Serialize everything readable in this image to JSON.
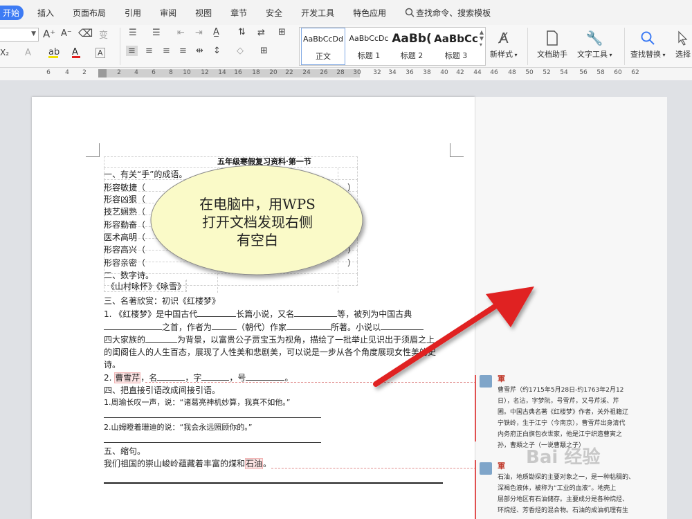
{
  "menu": {
    "start": "开始",
    "items": [
      "插入",
      "页面布局",
      "引用",
      "审阅",
      "视图",
      "章节",
      "安全",
      "开发工具",
      "特色应用"
    ],
    "search": "查找命令、搜索模板"
  },
  "ribbon": {
    "styles": [
      {
        "preview": "AaBbCcDd",
        "name": "正文"
      },
      {
        "preview": "AaBbCcDc",
        "name": "标题 1"
      },
      {
        "preview": "AaBb(",
        "name": "标题 2"
      },
      {
        "preview": "AaBbCc",
        "name": "标题 3"
      }
    ],
    "new_style": "新样式",
    "doc_helper": "文档助手",
    "text_tools": "文字工具",
    "find_replace": "查找替换",
    "select": "选择"
  },
  "ruler": {
    "ticks": [
      "6",
      "4",
      "2",
      "2",
      "4",
      "6",
      "8",
      "10",
      "12",
      "14",
      "16",
      "18",
      "20",
      "22",
      "24",
      "26",
      "28",
      "30",
      "32",
      "34",
      "36",
      "38",
      "40",
      "42",
      "44",
      "46",
      "48",
      "50",
      "52",
      "54",
      "56",
      "58",
      "60",
      "62"
    ]
  },
  "document": {
    "title": "五年级寒假复习资料·第一节",
    "section1": "一、有关“手”的成语。",
    "idioms": [
      "形容敏捷（",
      "形容凶狠（",
      "技艺娴熟（",
      "形容勤奋（",
      "医术高明（",
      "形容高兴（",
      "形容亲密（"
    ],
    "close_paren": "）",
    "section2": "二、数字诗。",
    "poems": "《山村咏怀》《咏雪》",
    "section3": "三、名著欣赏：初识《红楼梦》",
    "q1_line1_a": "1. 《红楼梦》是中国古代",
    "q1_line1_b": "长篇小说，又名",
    "q1_line1_c": "等，被列为中国古典",
    "q1_line2_a": "之首，作者为",
    "q1_line2_b": "（朝代）作家",
    "q1_line2_c": "所著。小说以",
    "q1_line3_a": "四大家族的",
    "q1_line3_b": "为背景，以富贵公子贾宝玉为视角，描绘了一批举止见识出于须眉之上",
    "q1_line4": "的闺阁佳人的人生百态，展现了人性美和悲剧美，可以说是一步从各个角度展现女性美的史",
    "q1_line5": "诗。",
    "q2_a": "2.",
    "q2_name": "曹雪芹",
    "q2_b": "，名",
    "q2_c": "，字",
    "q2_d": "，号",
    "q2_e": "。",
    "section4": "四、把直接引语改成间接引语。",
    "s4_q1": "1.周瑜长叹一声，说：“诸葛亮神机妙算，我真不如他。”",
    "s4_q2": "2.山姆瞪着珊迪的说：“我会永远照顾你的。”",
    "section5": "五、缩句。",
    "s5_sentence_a": "我们祖国的崇山峻岭蕴藏着丰富的煤和",
    "s5_oil": "石油",
    "s5_sentence_b": "。"
  },
  "callout": {
    "line1": "在电脑中，用WPS",
    "line2": "打开文档发现右侧",
    "line3": "有空白"
  },
  "comments": [
    {
      "author": "軍",
      "lines": [
        "曹雪芹（约1715年5月28日-约1763年2月12",
        "日），名沾，字梦阮，号雪芹，又号芹溪、芹",
        "圃。中国古典名著《红楼梦》作者，关外祖籍辽",
        "宁铁岭，生于江宁（今南京），曹雪芹出身清代",
        "内务府正白旗包衣世家，他是江宁织造曹寅之",
        "孙，曹頫之子（一说曹颙之子）"
      ]
    },
    {
      "author": "軍",
      "lines": [
        "石油，地质勘探的主要对象之一，是一种粘稠的、",
        "深褐色液体，被称为“工业的血液”。地壳上",
        "层部分地区有石油储存。主要成分是各种烷烃、",
        "环烷烃、芳香烃的混合物。石油的成油机理有生"
      ]
    }
  ],
  "watermark": "Bai 经验",
  "colors": {
    "accent": "#3d7bf4",
    "arrow": "#e02020",
    "callout_fill": "#fafac8",
    "comment_author": "#c0392b"
  }
}
